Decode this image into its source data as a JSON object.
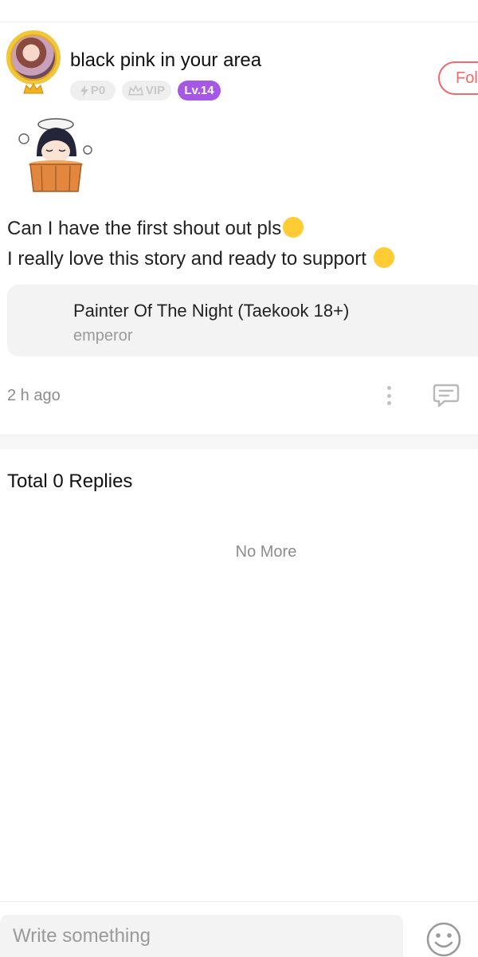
{
  "post": {
    "username": "black pink in your area",
    "badges": {
      "power": "P0",
      "vip": "VIP",
      "level": "Lv.14"
    },
    "follow_label": "Fol",
    "comment_lines": [
      "Can I have the first shout out pls",
      "I really love this story and ready to support "
    ],
    "book": {
      "title": "Painter Of The Night (Taekook 18+)",
      "author": "emperor"
    },
    "time": "2 h ago"
  },
  "replies": {
    "title": "Total 0 Replies",
    "end_text": "No More"
  },
  "composer": {
    "placeholder": "Write something"
  },
  "colors": {
    "accent": "#f06a6a",
    "level_badge": "#a558e6",
    "muted_text": "#8c8c8c"
  },
  "icons": {
    "more": "more-vertical-icon",
    "reply": "comment-icon",
    "emoji": "emoji-smile-icon"
  }
}
